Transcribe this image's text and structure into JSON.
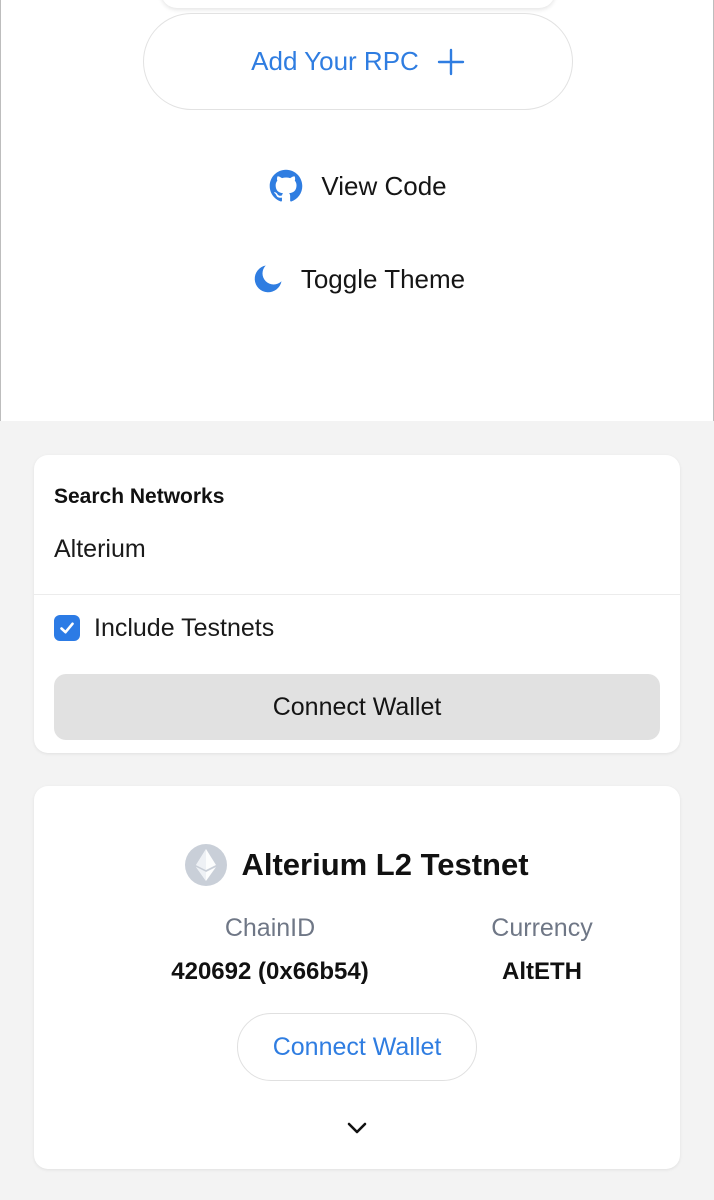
{
  "menu": {
    "add_rpc_label": "Add Your RPC",
    "view_code_label": "View Code",
    "toggle_theme_label": "Toggle Theme"
  },
  "search": {
    "label": "Search Networks",
    "value": "Alterium",
    "include_testnets_label": "Include Testnets",
    "include_testnets_checked": true,
    "connect_wallet_label": "Connect Wallet"
  },
  "network": {
    "name": "Alterium L2 Testnet",
    "chain_id_label": "ChainID",
    "chain_id_value": "420692 (0x66b54)",
    "currency_label": "Currency",
    "currency_value": "AltETH",
    "connect_wallet_label": "Connect Wallet"
  },
  "icons": {
    "add": "plus-icon",
    "code": "github-icon",
    "theme": "moon-icon",
    "checkbox": "checkmark-icon",
    "network": "ethereum-icon",
    "expand": "chevron-down-icon"
  },
  "colors": {
    "accent": "#2f7de1",
    "checkbox": "#2c7be5",
    "muted": "#6f7786",
    "page_bg": "#f3f3f3",
    "button_gray": "#e1e1e1"
  }
}
